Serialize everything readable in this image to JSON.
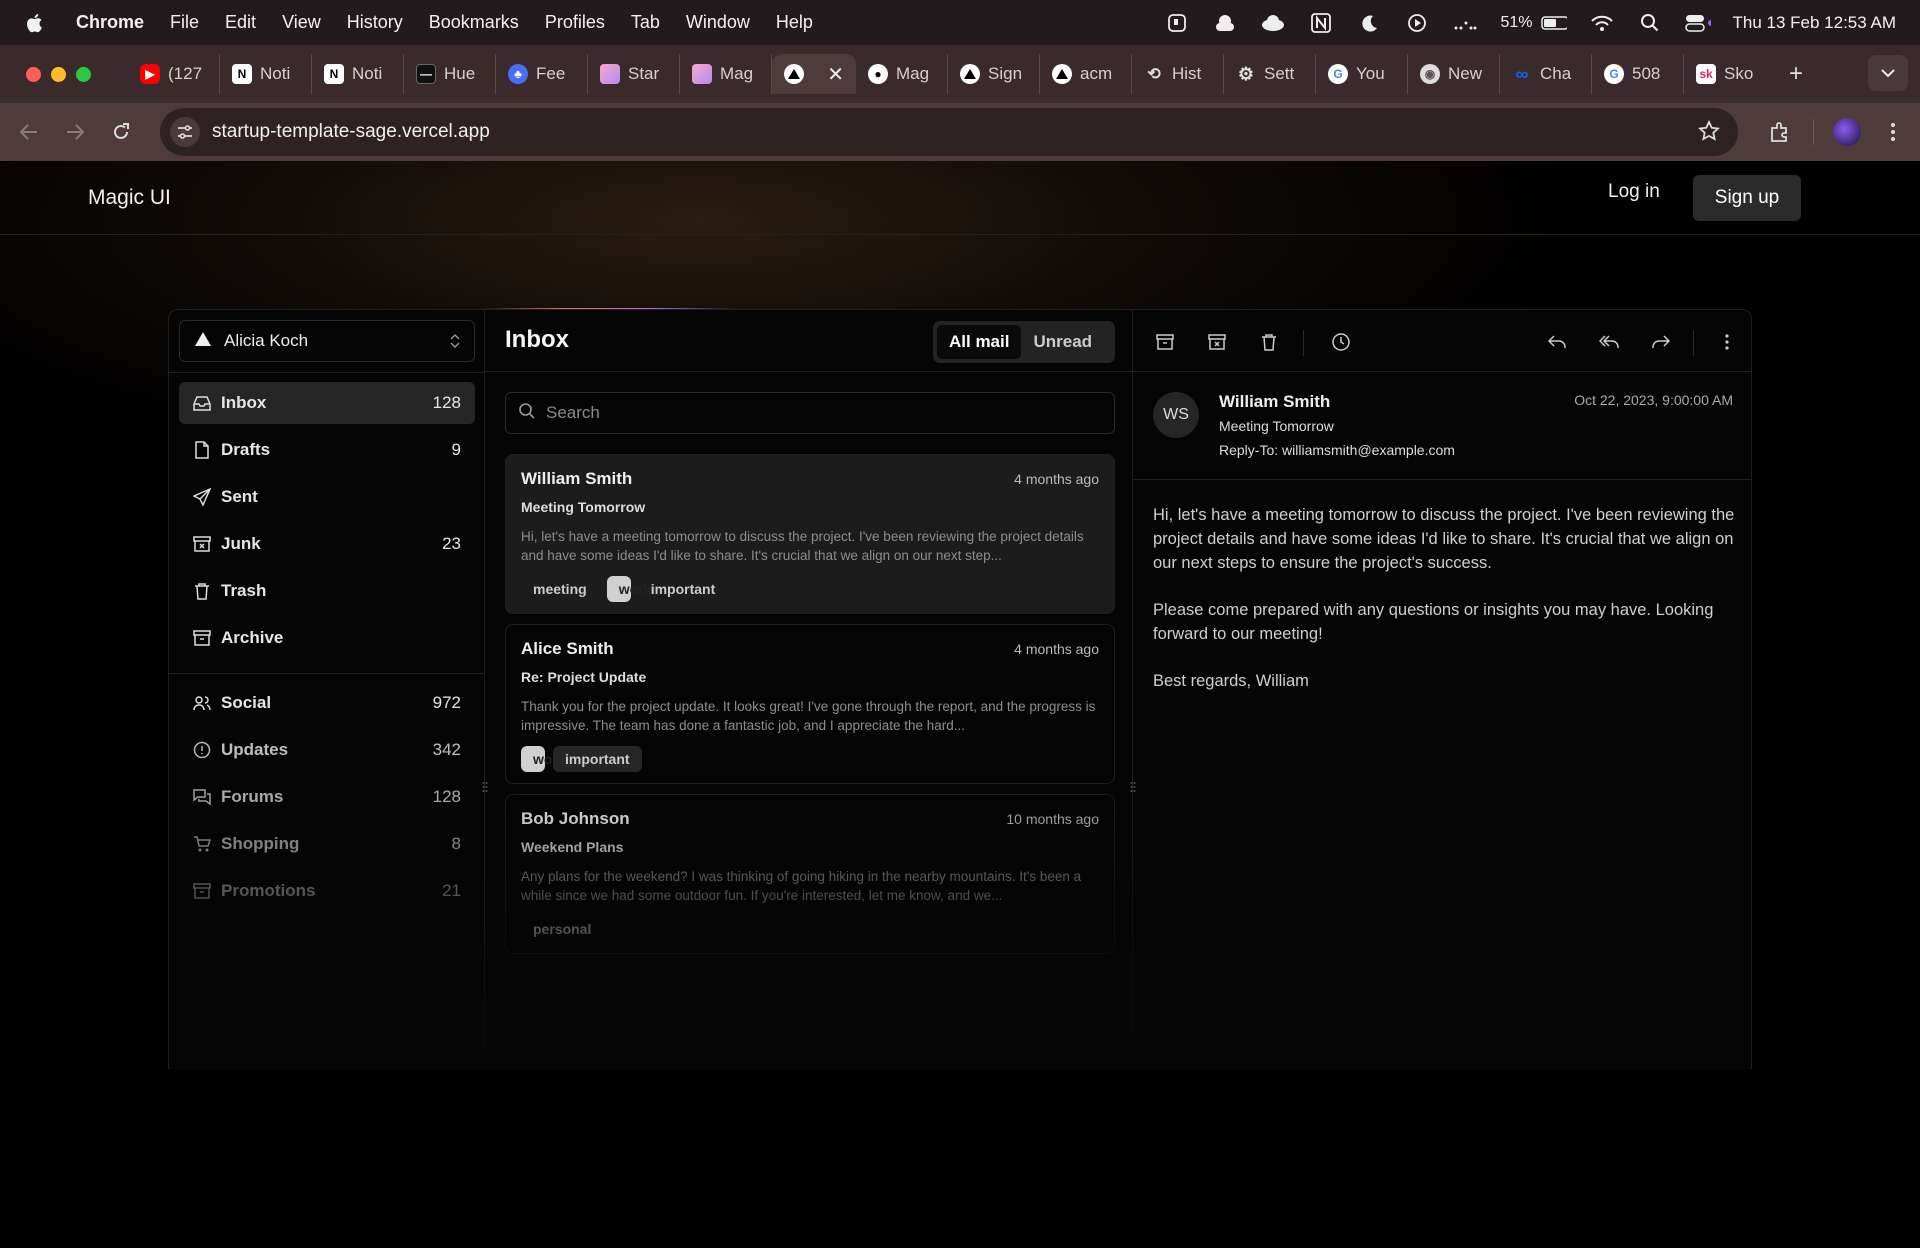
{
  "menubar": {
    "app_name": "Chrome",
    "items": [
      "File",
      "Edit",
      "View",
      "History",
      "Bookmarks",
      "Profiles",
      "Tab",
      "Window",
      "Help"
    ],
    "battery": "51%",
    "datetime": "Thu 13 Feb  12:53 AM"
  },
  "tabs": [
    {
      "label": "(127",
      "icon": "youtube-icon",
      "color": "#ff0000"
    },
    {
      "label": "Noti",
      "icon": "notion-icon",
      "color": "#ffffff"
    },
    {
      "label": "Noti",
      "icon": "notion-icon",
      "color": "#ffffff"
    },
    {
      "label": "Hue",
      "icon": "hue-icon",
      "color": "#111111"
    },
    {
      "label": "Fee",
      "icon": "feedback-icon",
      "color": "#4a6cf7"
    },
    {
      "label": "Star",
      "icon": "gradient-icon",
      "color": "#e9a0d0"
    },
    {
      "label": "Mag",
      "icon": "gradient-icon",
      "color": "#d9a0e0"
    },
    {
      "label": "",
      "icon": "triangle-icon",
      "color": "#ffffff",
      "active": true
    },
    {
      "label": "Mag",
      "icon": "github-icon",
      "color": "#ffffff"
    },
    {
      "label": "Sign",
      "icon": "triangle-icon",
      "color": "#ffffff"
    },
    {
      "label": "acm",
      "icon": "triangle-icon",
      "color": "#ffffff"
    },
    {
      "label": "Hist",
      "icon": "history-icon",
      "color": "#dddddd"
    },
    {
      "label": "Sett",
      "icon": "gear-icon",
      "color": "#dddddd"
    },
    {
      "label": "You",
      "icon": "google-icon",
      "color": "#4285f4"
    },
    {
      "label": "New",
      "icon": "chrome-icon",
      "color": "#dddddd"
    },
    {
      "label": "Cha",
      "icon": "meta-icon",
      "color": "#0866ff"
    },
    {
      "label": "508",
      "icon": "google-icon",
      "color": "#4285f4"
    },
    {
      "label": "Sko",
      "icon": "sk-icon",
      "color": "#e0245e"
    }
  ],
  "toolbar": {
    "url": "startup-template-sage.vercel.app"
  },
  "site": {
    "brand": "Magic UI",
    "login": "Log in",
    "signup": "Sign up"
  },
  "sidebar": {
    "account": "Alicia Koch",
    "primary": [
      {
        "label": "Inbox",
        "count": "128",
        "icon": "inbox-icon",
        "active": true
      },
      {
        "label": "Drafts",
        "count": "9",
        "icon": "file-icon"
      },
      {
        "label": "Sent",
        "count": "",
        "icon": "send-icon"
      },
      {
        "label": "Junk",
        "count": "23",
        "icon": "archive-x-icon"
      },
      {
        "label": "Trash",
        "count": "",
        "icon": "trash-icon"
      },
      {
        "label": "Archive",
        "count": "",
        "icon": "archive-icon"
      }
    ],
    "secondary": [
      {
        "label": "Social",
        "count": "972",
        "icon": "users-icon"
      },
      {
        "label": "Updates",
        "count": "342",
        "icon": "alert-circle-icon"
      },
      {
        "label": "Forums",
        "count": "128",
        "icon": "messages-icon"
      },
      {
        "label": "Shopping",
        "count": "8",
        "icon": "cart-icon"
      },
      {
        "label": "Promotions",
        "count": "21",
        "icon": "archive-icon"
      }
    ]
  },
  "inbox": {
    "title": "Inbox",
    "filter_all": "All mail",
    "filter_unread": "Unread",
    "search_placeholder": "Search",
    "mails": [
      {
        "from": "William Smith",
        "time": "4 months ago",
        "subject": "Meeting Tomorrow",
        "preview": "Hi, let's have a meeting tomorrow to discuss the project. I've been reviewing the project details and have some ideas I'd like to share. It's crucial that we align on our next step...",
        "tags": [
          "meeting",
          "work",
          "important"
        ]
      },
      {
        "from": "Alice Smith",
        "time": "4 months ago",
        "subject": "Re: Project Update",
        "preview": "Thank you for the project update. It looks great! I've gone through the report, and the progress is impressive. The team has done a fantastic job, and I appreciate the hard...",
        "tags": [
          "work",
          "important"
        ]
      },
      {
        "from": "Bob Johnson",
        "time": "10 months ago",
        "subject": "Weekend Plans",
        "preview": "Any plans for the weekend? I was thinking of going hiking in the nearby mountains. It's been a while since we had some outdoor fun. If you're interested, let me know, and we...",
        "tags": [
          "personal"
        ]
      }
    ]
  },
  "reader": {
    "initials": "WS",
    "from": "William Smith",
    "subject": "Meeting Tomorrow",
    "reply_to": "Reply-To: williamsmith@example.com",
    "date": "Oct 22, 2023, 9:00:00 AM",
    "body": [
      "Hi, let's have a meeting tomorrow to discuss the project. I've been reviewing the project details and have some ideas I'd like to share. It's crucial that we align on our next steps to ensure the project's success.",
      "Please come prepared with any questions or insights you may have. Looking forward to our meeting!",
      "Best regards, William"
    ]
  }
}
